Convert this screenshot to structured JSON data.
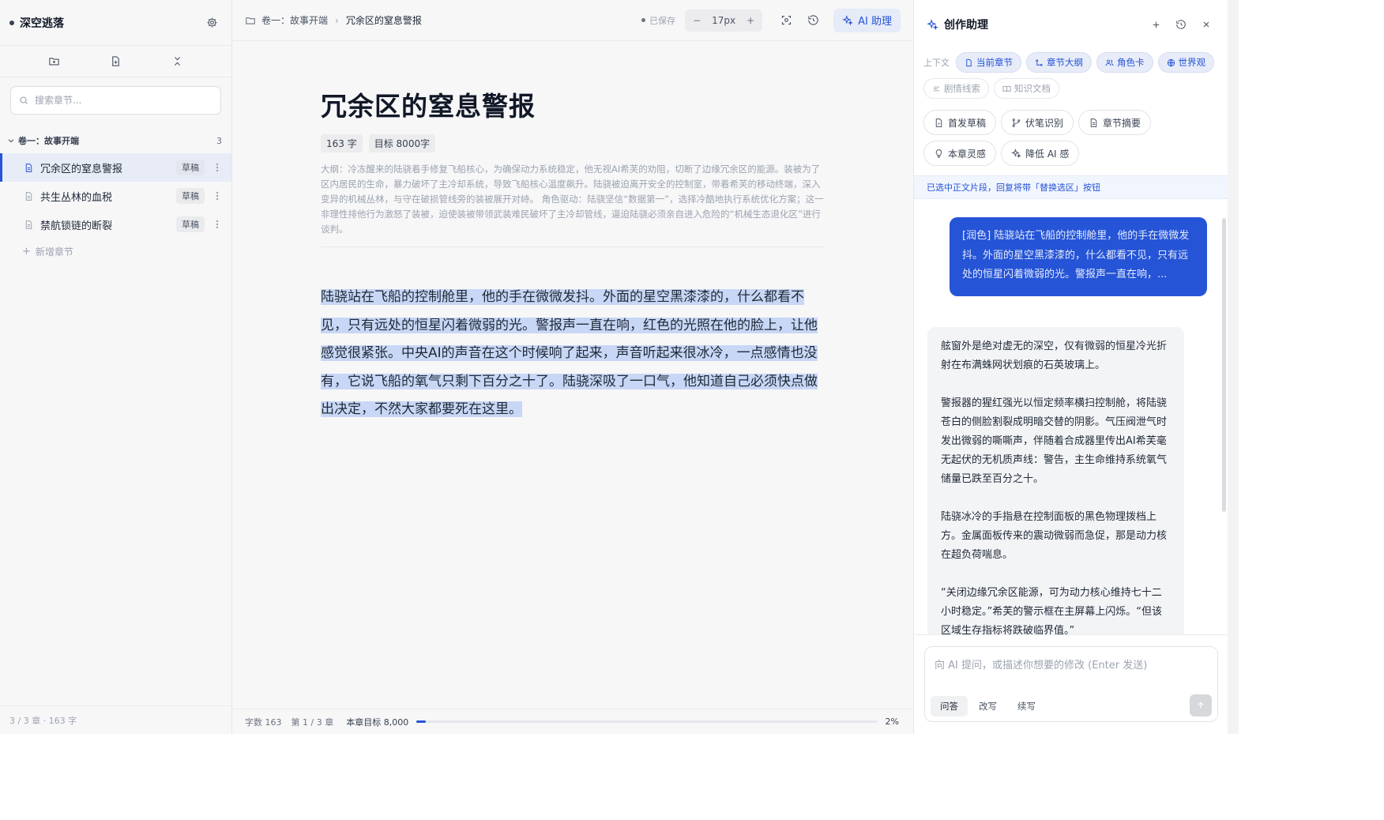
{
  "sidebar": {
    "title": "深空逃落",
    "search_placeholder": "搜索章节...",
    "volume": {
      "title": "卷一：故事开端",
      "count": "3"
    },
    "chapters": [
      {
        "title": "冗余区的窒息警报",
        "status": "草稿"
      },
      {
        "title": "共生丛林的血税",
        "status": "草稿"
      },
      {
        "title": "禁航锁链的断裂",
        "status": "草稿"
      }
    ],
    "add_chapter": "新增章节",
    "footer": "3 / 3 章 · 163 字"
  },
  "editor": {
    "breadcrumb": {
      "volume": "卷一：故事开端",
      "chapter": "冗余区的窒息警报"
    },
    "saved": "已保存",
    "font_size": "17px",
    "ai_button": "AI 助理",
    "title": "冗余区的窒息警报",
    "word_count": "163 字",
    "target": "目标 8000字",
    "outline": "大纲：冷冻醒来的陆骁着手修复飞船核心，为确保动力系统稳定，他无视AI希芙的劝阻，切断了边缘冗余区的能源。装被为了区内居民的生命，暴力破坏了主冷却系统，导致飞船核心温度飙升。陆骁被迫离开安全的控制室，带着希芙的移动终端，深入变异的机械丛林，与守在破损管线旁的装被展开对峙。 角色驱动：陆骁坚信“数据第一”，选择冷酷地执行系统优化方案；这一非理性排他行为激怒了装被，迫使装被带领武装难民破坏了主冷却管线，逼迫陆骁必须亲自进入危险的“机械生态退化区”进行谈判。",
    "body": "陆骁站在飞船的控制舱里，他的手在微微发抖。外面的星空黑漆漆的，什么都看不见，只有远处的恒星闪着微弱的光。警报声一直在响，红色的光照在他的脸上，让他感觉很紧张。中央AI的声音在这个时候响了起来，声音听起来很冰冷，一点感情也没有，它说飞船的氧气只剩下百分之十了。陆骁深吸了一口气，他知道自己必须快点做出决定，不然大家都要死在这里。",
    "footer": {
      "word_count": "字数 163",
      "chapter_pos": "第 1 / 3 章",
      "goal": "本章目标 8,000",
      "progress_percent": 2,
      "progress_label": "2%"
    }
  },
  "panel": {
    "title": "创作助理",
    "context_label": "上下文",
    "context_chips": [
      {
        "label": "当前章节",
        "icon": "document-icon",
        "active": true
      },
      {
        "label": "章节大纲",
        "icon": "outline-icon",
        "active": true
      },
      {
        "label": "角色卡",
        "icon": "people-icon",
        "active": true
      },
      {
        "label": "世界观",
        "icon": "globe-icon",
        "active": true
      },
      {
        "label": "剧情线索",
        "icon": "thread-icon",
        "active": false
      },
      {
        "label": "知识文档",
        "icon": "book-icon",
        "active": false
      }
    ],
    "actions": [
      {
        "label": "首发草稿",
        "icon": "draft-icon"
      },
      {
        "label": "伏笔识别",
        "icon": "branch-icon"
      },
      {
        "label": "章节摘要",
        "icon": "summary-icon"
      },
      {
        "label": "本章灵感",
        "icon": "lightbulb-icon"
      },
      {
        "label": "降低 AI 感",
        "icon": "sparkle-icon"
      }
    ],
    "notice": "已选中正文片段，回复将带「替换选区」按钮",
    "user_message": "[润色] 陆骁站在飞船的控制舱里，他的手在微微发抖。外面的星空黑漆漆的，什么都看不见，只有远处的恒星闪着微弱的光。警报声一直在响，...",
    "ai_paragraphs": [
      "舷窗外是绝对虚无的深空，仅有微弱的恒星冷光折射在布满蛛网状划痕的石英玻璃上。",
      "警报器的猩红强光以恒定频率横扫控制舱，将陆骁苍白的侧脸割裂成明暗交替的阴影。气压阀泄气时发出微弱的嘶嘶声，伴随着合成器里传出AI希芙毫无起伏的无机质声线：警告，主生命维持系统氧气储量已跌至百分之十。",
      "陆骁冰冷的手指悬在控制面板的黑色物理拨档上方。金属面板传来的震动微弱而急促，那是动力核在超负荷喘息。",
      "“关闭边缘冗余区能源，可为动力核心维持七十二小时稳定。”希芙的警示框在主屏幕上闪烁。“但该区域生存指标将跌破临界值。”"
    ],
    "input_placeholder": "向 AI 提问，或描述你想要的修改 (Enter 发送)",
    "modes": [
      {
        "label": "问答",
        "active": true
      },
      {
        "label": "改写",
        "active": false
      },
      {
        "label": "续写",
        "active": false
      }
    ]
  }
}
